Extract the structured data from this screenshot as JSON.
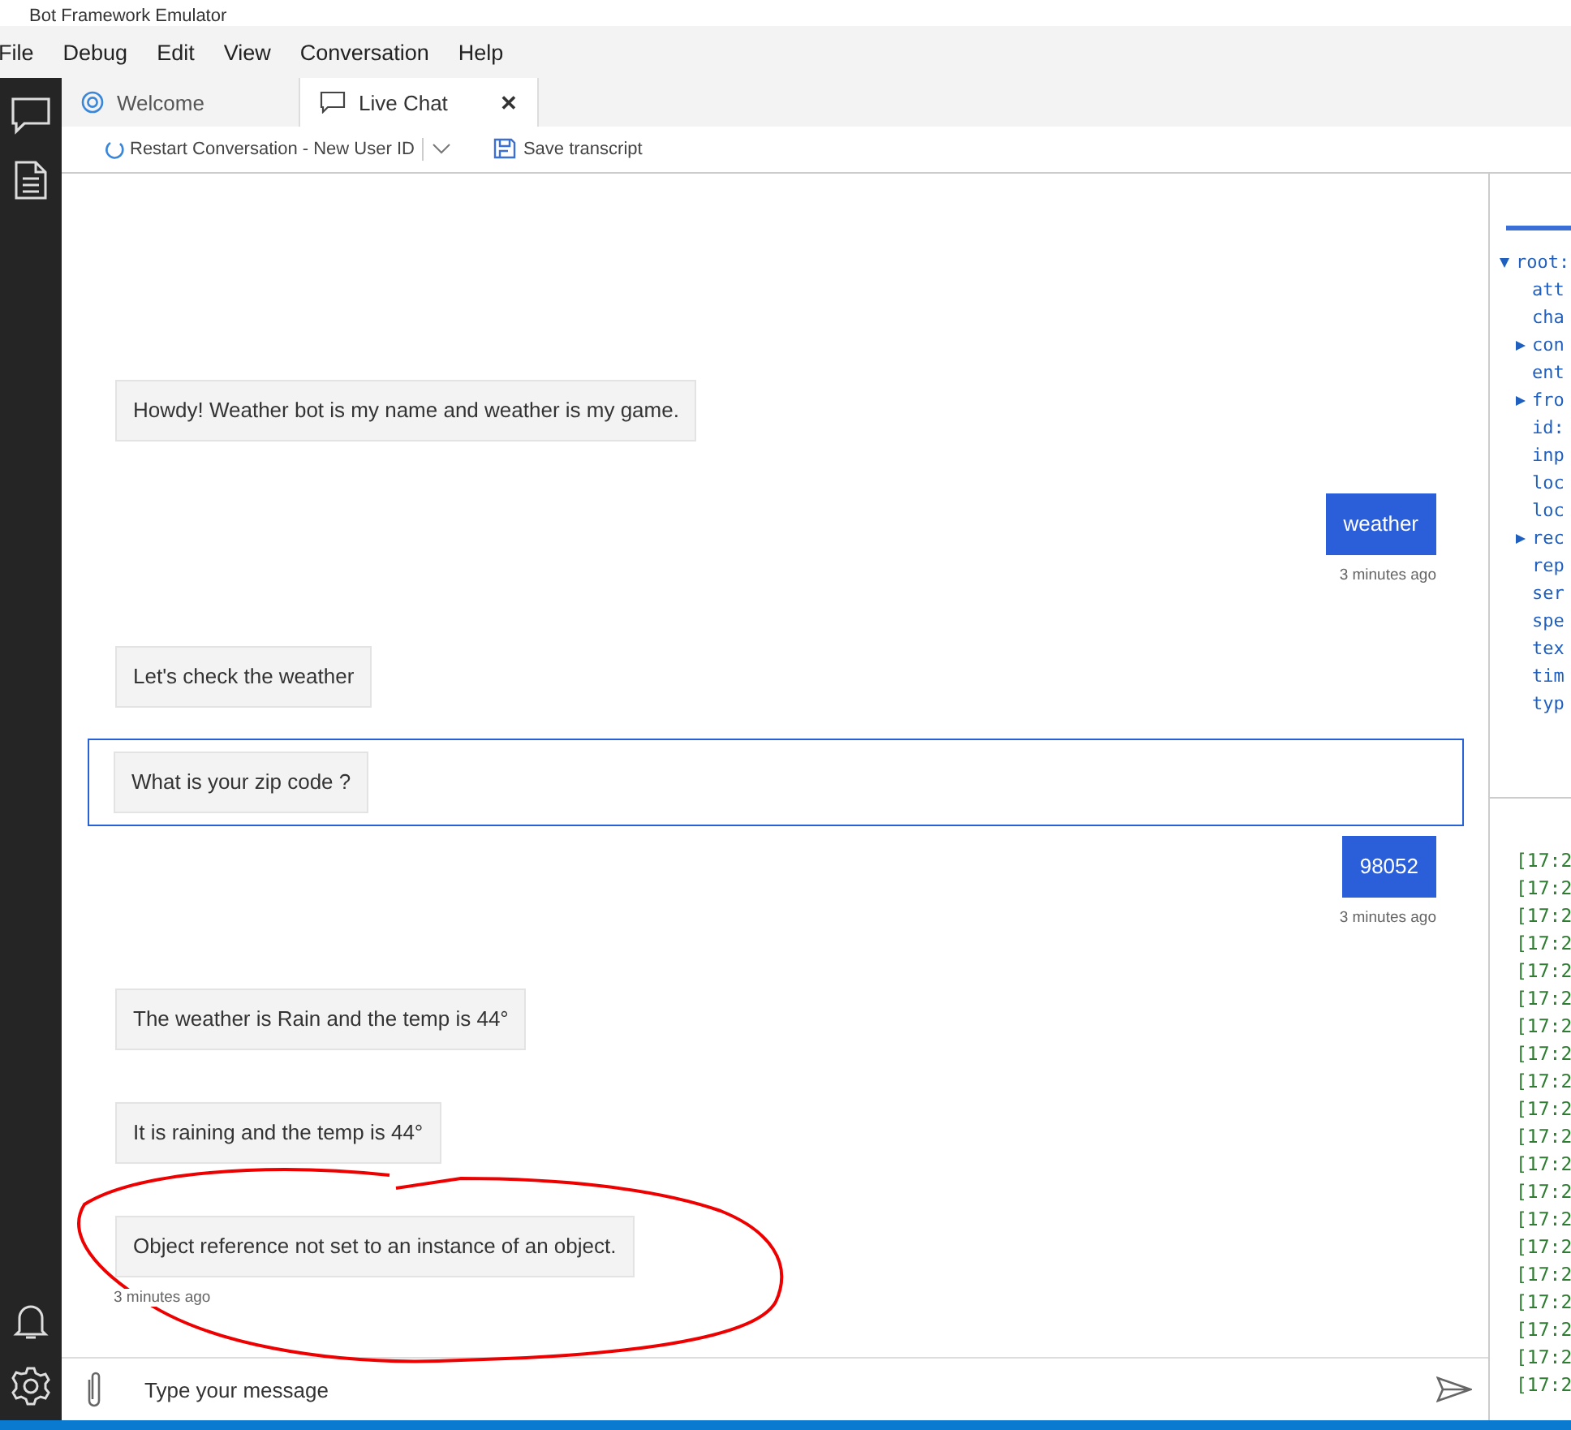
{
  "window": {
    "title": "Bot Framework Emulator"
  },
  "menu": [
    "File",
    "Debug",
    "Edit",
    "View",
    "Conversation",
    "Help"
  ],
  "tabs": [
    {
      "label": "Welcome",
      "kind": "welcome",
      "selected": false
    },
    {
      "label": "Live Chat",
      "kind": "chat",
      "selected": true,
      "close": "✕"
    }
  ],
  "toolbar": {
    "restart": "Restart Conversation - New User ID",
    "save": "Save transcript"
  },
  "messages": [
    {
      "kind": "bot",
      "text": "Howdy! Weather bot is my name and weather is my game.",
      "selected": false
    },
    {
      "kind": "user",
      "text": "weather",
      "time": "3 minutes ago",
      "selected": false
    },
    {
      "kind": "bot",
      "text": "Let's check the weather",
      "selected": false
    },
    {
      "kind": "bot",
      "text": "What is your zip code ?",
      "selected": true
    },
    {
      "kind": "user",
      "text": "98052",
      "time": "3 minutes ago",
      "selected": false
    },
    {
      "kind": "bot",
      "text": "The weather is Rain and the temp is 44°",
      "selected": false
    },
    {
      "kind": "bot",
      "text": "It is raining and the temp is 44°",
      "selected": false
    },
    {
      "kind": "bot",
      "text": "Object reference not set to an instance of an object.",
      "time": "3 minutes ago",
      "selected": false
    }
  ],
  "input": {
    "placeholder": "Type your message"
  },
  "inspector": {
    "tree": {
      "label": "root:",
      "expanded": true,
      "children": [
        {
          "label": "att"
        },
        {
          "label": "cha"
        },
        {
          "label": "con",
          "expanded": false
        },
        {
          "label": "ent"
        },
        {
          "label": "fro",
          "expanded": false
        },
        {
          "label": "id:"
        },
        {
          "label": "inp"
        },
        {
          "label": "loc"
        },
        {
          "label": "loc"
        },
        {
          "label": "rec",
          "expanded": false
        },
        {
          "label": "rep"
        },
        {
          "label": "ser"
        },
        {
          "label": "spe"
        },
        {
          "label": "tex"
        },
        {
          "label": "tim"
        },
        {
          "label": "typ"
        }
      ]
    }
  },
  "log": [
    "[17:2",
    "[17:2",
    "[17:2",
    "[17:2",
    "[17:2",
    "[17:2",
    "[17:2",
    "[17:2",
    "[17:2",
    "[17:2",
    "[17:2",
    "[17:2",
    "[17:2",
    "[17:2",
    "[17:2",
    "[17:2",
    "[17:2",
    "[17:2",
    "[17:2",
    "[17:2"
  ]
}
